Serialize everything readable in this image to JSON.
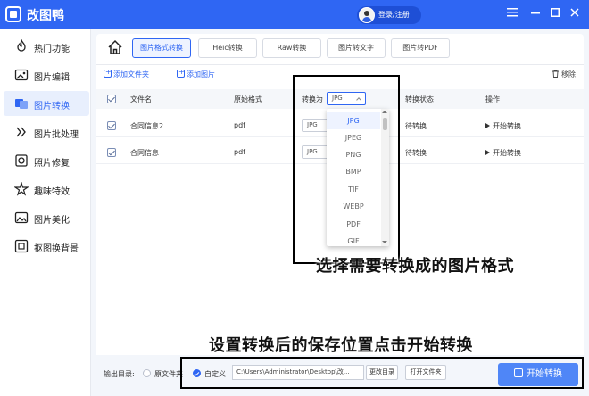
{
  "app": {
    "title": "改图鸭",
    "brand_color": "#2f66f3"
  },
  "titlebar": {
    "login_label": "登录/注册",
    "menu_icon": "hamburger-icon",
    "minimize_icon": "minimize-icon",
    "maximize_icon": "maximize-icon",
    "close_icon": "close-icon"
  },
  "sidebar": {
    "items": [
      {
        "label": "热门功能",
        "icon": "fire-icon"
      },
      {
        "label": "图片编辑",
        "icon": "image-edit-icon"
      },
      {
        "label": "图片转换",
        "icon": "image-convert-icon",
        "active": true
      },
      {
        "label": "图片批处理",
        "icon": "batch-icon"
      },
      {
        "label": "照片修复",
        "icon": "photo-repair-icon"
      },
      {
        "label": "趣味特效",
        "icon": "effects-icon"
      },
      {
        "label": "图片美化",
        "icon": "beautify-icon"
      },
      {
        "label": "抠图换背景",
        "icon": "cutout-icon"
      }
    ]
  },
  "tabs": [
    {
      "label": "图片格式转换",
      "active": true
    },
    {
      "label": "Heic转换"
    },
    {
      "label": "Raw转换"
    },
    {
      "label": "图片转文字"
    },
    {
      "label": "图片转PDF"
    }
  ],
  "toolbar": {
    "add_folder": "添加文件夹",
    "add_image": "添加图片",
    "remove": "移除"
  },
  "table": {
    "headers": {
      "filename": "文件名",
      "original_format": "原始格式",
      "convert_to": "转换为",
      "status": "转换状态",
      "action": "操作"
    },
    "header_select_value": "JPG",
    "rows": [
      {
        "name": "合同信息2",
        "format": "pdf",
        "target": "JPG",
        "status": "待转换",
        "action": "开始转换"
      },
      {
        "name": "合同信息",
        "format": "pdf",
        "target": "JPG",
        "status": "待转换",
        "action": "开始转换"
      }
    ]
  },
  "dropdown": {
    "options": [
      "JPG",
      "JPEG",
      "PNG",
      "BMP",
      "TIF",
      "WEBP",
      "PDF",
      "GIF"
    ],
    "selected": "JPG"
  },
  "annotations": {
    "format_hint": "选择需要转换成的图片格式",
    "save_hint": "设置转换后的保存位置点击开始转换"
  },
  "bottom": {
    "output_label": "输出目录:",
    "option_original": "原文件夹",
    "option_custom": "自定义",
    "path": "C:\\Users\\Administrator\\Desktop\\改...",
    "change_dir": "更改目录",
    "open_folder": "打开文件夹",
    "start_convert": "开始转换"
  }
}
